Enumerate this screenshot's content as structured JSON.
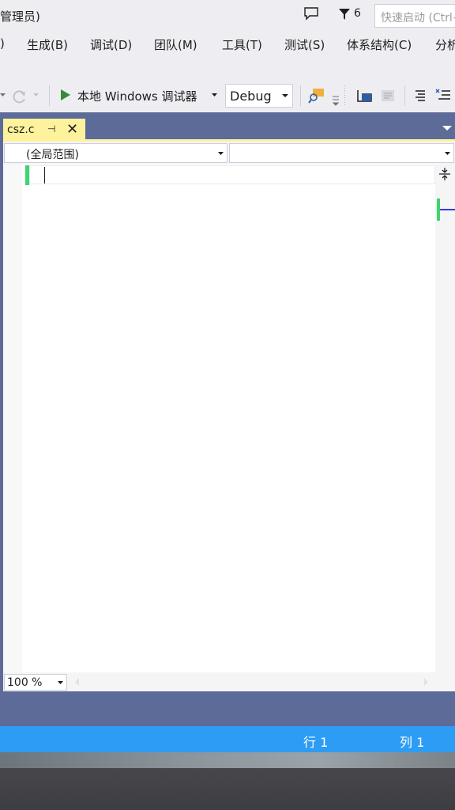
{
  "window": {
    "title": "管理员)",
    "notification_count": "6",
    "quick_launch_placeholder": "快速启动 (Ctrl+Q)"
  },
  "menu": {
    "items": [
      {
        "label": ")"
      },
      {
        "label": "生成(B)"
      },
      {
        "label": "调试(D)"
      },
      {
        "label": "团队(M)"
      },
      {
        "label": "工具(T)"
      },
      {
        "label": "测试(S)"
      },
      {
        "label": "体系结构(C)"
      },
      {
        "label": "分析"
      }
    ]
  },
  "toolbar": {
    "run_label": "本地 Windows 调试器",
    "configuration": "Debug",
    "icons": [
      "undo-dropdown-icon",
      "redo-icon",
      "start-debug-icon",
      "find-icon",
      "bookmark-icon",
      "format-icon",
      "comment-icon"
    ]
  },
  "document": {
    "tab_label": "csz.c",
    "tab_pin_glyph": "⊣",
    "tab_close_glyph": "✕",
    "scope": "(全局范围)",
    "member": "",
    "zoom": "100 %"
  },
  "status": {
    "line": "行 1",
    "column": "列 1"
  },
  "colors": {
    "chrome": "#eeeef2",
    "doc_well": "#5d6b99",
    "active_tab": "#fff29d",
    "status_bar": "#2d9cf5",
    "change_marker": "#3ed46e"
  }
}
